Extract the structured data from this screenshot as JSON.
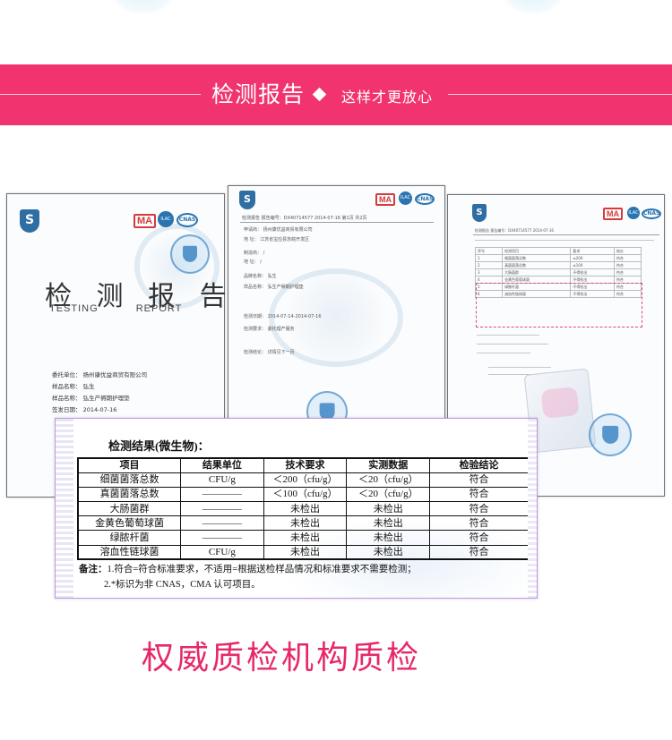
{
  "banner": {
    "title": "检测报告",
    "subtitle": "这样才更放心"
  },
  "cover_report": {
    "ma_badge": "MA",
    "title": "检 测 报 告",
    "title_en_left": "TESTING",
    "title_en_right": "REPORT",
    "info": [
      "委托单位：   扬州康优益商贸有限公司",
      "样品名称：   弘生",
      "样品名称：   弘生产褥期护理垫",
      "签发日期：   2014-07-16"
    ]
  },
  "middle_report": {
    "ma_badge": "MA",
    "header": "检测报告        报告编号：DX40714577        2014-07-16        第1页 共2页",
    "rows": [
      "申请商：   扬州康优益商贸有限公司",
      "地   址：   江苏省宝应县苏皖开发区",
      "制造商：   /",
      "地   址：   /",
      "品牌名称：   弘生",
      "样品名称：   弘生产褥期护理垫",
      "检测日期：   2014-07-14-2014-07-16",
      "检测要求：   委托理产服务",
      "检测结论：   详情见下一页"
    ]
  },
  "right_report": {
    "ma_badge": "MA",
    "header": "检测报告        报告编号：DX40714577        2014-07-16",
    "mini_rows": [
      [
        "序号",
        "检测项目",
        "要求",
        "结论"
      ],
      [
        "1",
        "细菌菌落总数",
        "≤200",
        "符合"
      ],
      [
        "2",
        "真菌菌落总数",
        "≤100",
        "符合"
      ],
      [
        "3",
        "大肠菌群",
        "不得检出",
        "符合"
      ],
      [
        "4",
        "金黄色葡萄球菌",
        "不得检出",
        "符合"
      ],
      [
        "5",
        "绿脓杆菌",
        "不得检出",
        "符合"
      ],
      [
        "6",
        "溶血性链球菌",
        "不得检出",
        "符合"
      ]
    ]
  },
  "results": {
    "heading": "检测结果(微生物)：",
    "headers": [
      "项目",
      "结果单位",
      "技术要求",
      "实测数据",
      "检验结论"
    ],
    "rows": [
      [
        "细菌菌落总数",
        "CFU/g",
        "＜200（cfu/g）",
        "＜20（cfu/g）",
        "符合"
      ],
      [
        "真菌菌落总数",
        "————",
        "＜100（cfu/g）",
        "＜20（cfu/g）",
        "符合"
      ],
      [
        "大肠菌群",
        "————",
        "未检出",
        "未检出",
        "符合"
      ],
      [
        "金黄色葡萄球菌",
        "————",
        "未检出",
        "未检出",
        "符合"
      ],
      [
        "绿脓杆菌",
        "————",
        "未检出",
        "未检出",
        "符合"
      ],
      [
        "溶血性链球菌",
        "CFU/g",
        "未检出",
        "未检出",
        "符合"
      ]
    ],
    "note_label": "备注：",
    "note1": "1.符合=符合标准要求，不适用=根据送检样品情况和标准要求不需要检测；",
    "note2": "2.*标识为非 CNAS，CMA 认可项目。"
  },
  "bottom_title": "权威质检机构质检",
  "colors": {
    "banner": "#f1346f",
    "bottom_title": "#e6286b"
  }
}
